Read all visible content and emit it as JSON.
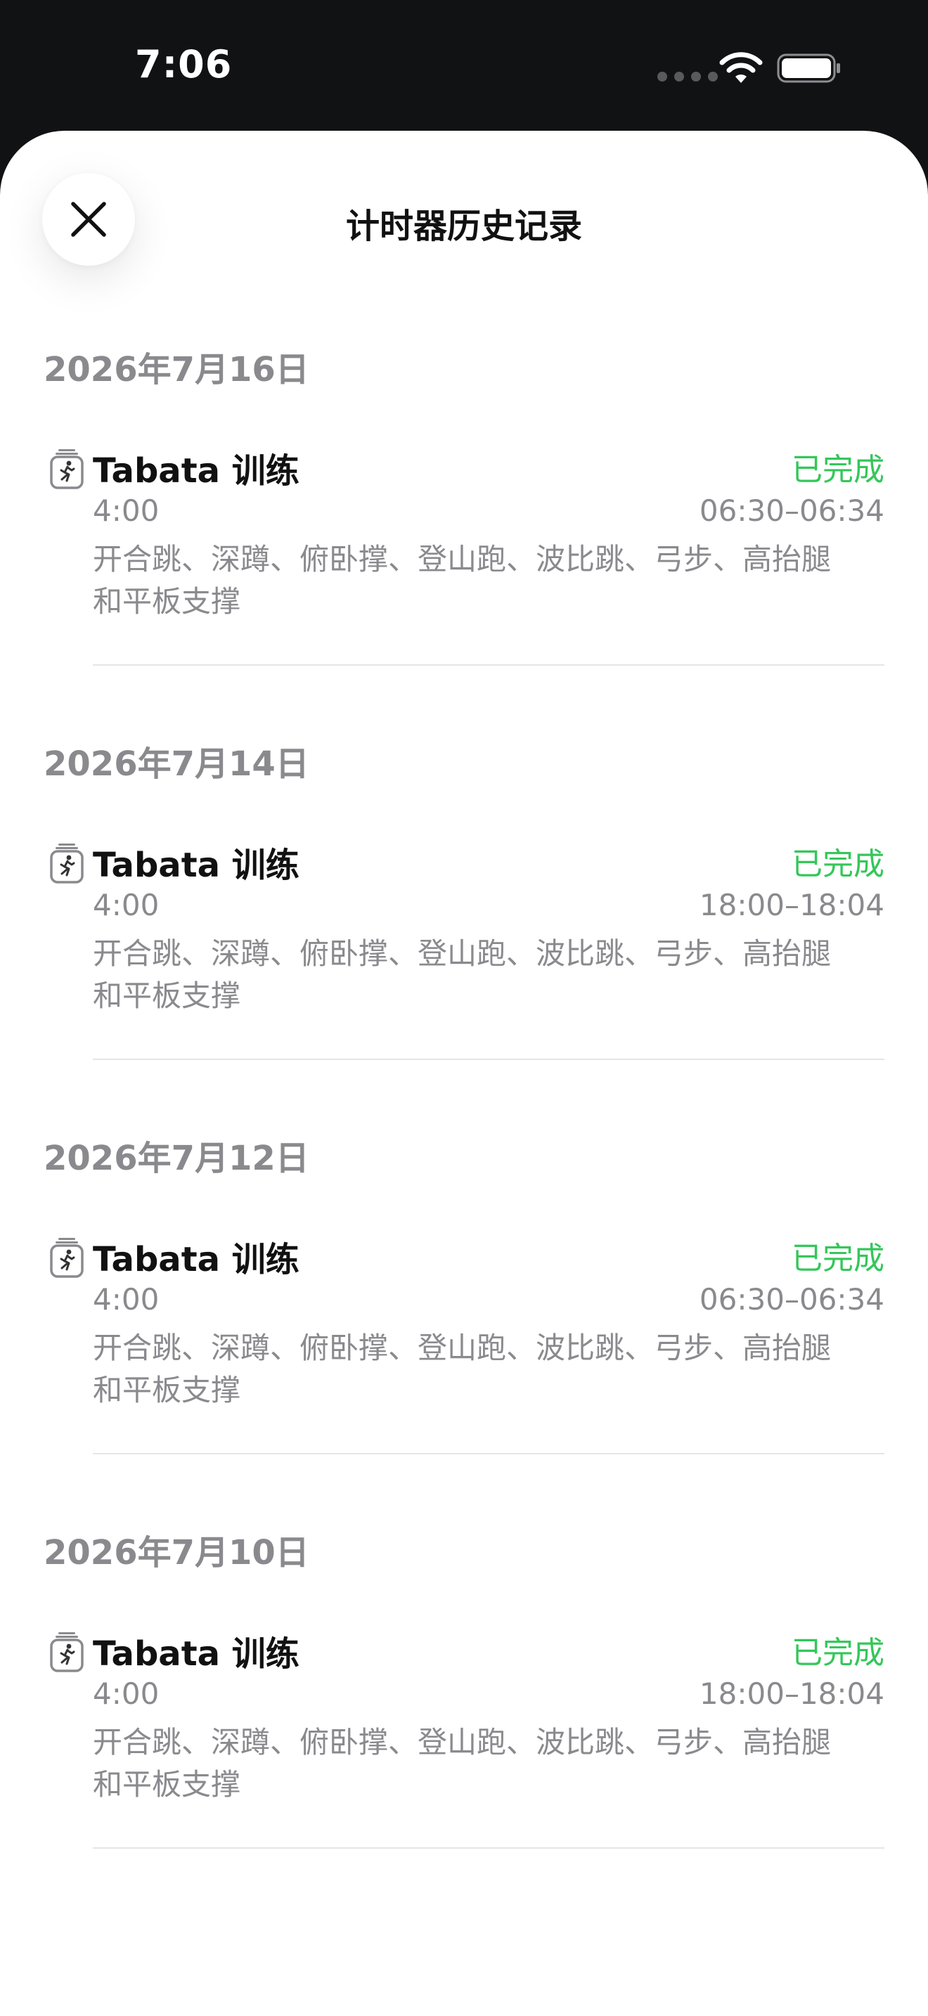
{
  "status_bar": {
    "time": "7:06",
    "wifi_icon": "wifi-icon",
    "battery_icon": "battery-icon"
  },
  "header": {
    "title": "计时器历史记录",
    "close_icon": "close-icon"
  },
  "colors": {
    "status_complete": "#34c759",
    "secondary_text": "#8a8a8e",
    "primary_text": "#111111",
    "background": "#111214",
    "sheet": "#ffffff"
  },
  "sections": [
    {
      "date": "2026年7月16日",
      "entry": {
        "icon": "timer-runner-icon",
        "title": "Tabata 训练",
        "status": "已完成",
        "duration": "4:00",
        "time_range": "06:30–06:34",
        "exercises": "开合跳、深蹲、俯卧撑、登山跑、波比跳、弓步、高抬腿和平板支撑"
      }
    },
    {
      "date": "2026年7月14日",
      "entry": {
        "icon": "timer-runner-icon",
        "title": "Tabata 训练",
        "status": "已完成",
        "duration": "4:00",
        "time_range": "18:00–18:04",
        "exercises": "开合跳、深蹲、俯卧撑、登山跑、波比跳、弓步、高抬腿和平板支撑"
      }
    },
    {
      "date": "2026年7月12日",
      "entry": {
        "icon": "timer-runner-icon",
        "title": "Tabata 训练",
        "status": "已完成",
        "duration": "4:00",
        "time_range": "06:30–06:34",
        "exercises": "开合跳、深蹲、俯卧撑、登山跑、波比跳、弓步、高抬腿和平板支撑"
      }
    },
    {
      "date": "2026年7月10日",
      "entry": {
        "icon": "timer-runner-icon",
        "title": "Tabata 训练",
        "status": "已完成",
        "duration": "4:00",
        "time_range": "18:00–18:04",
        "exercises": "开合跳、深蹲、俯卧撑、登山跑、波比跳、弓步、高抬腿和平板支撑"
      }
    }
  ]
}
